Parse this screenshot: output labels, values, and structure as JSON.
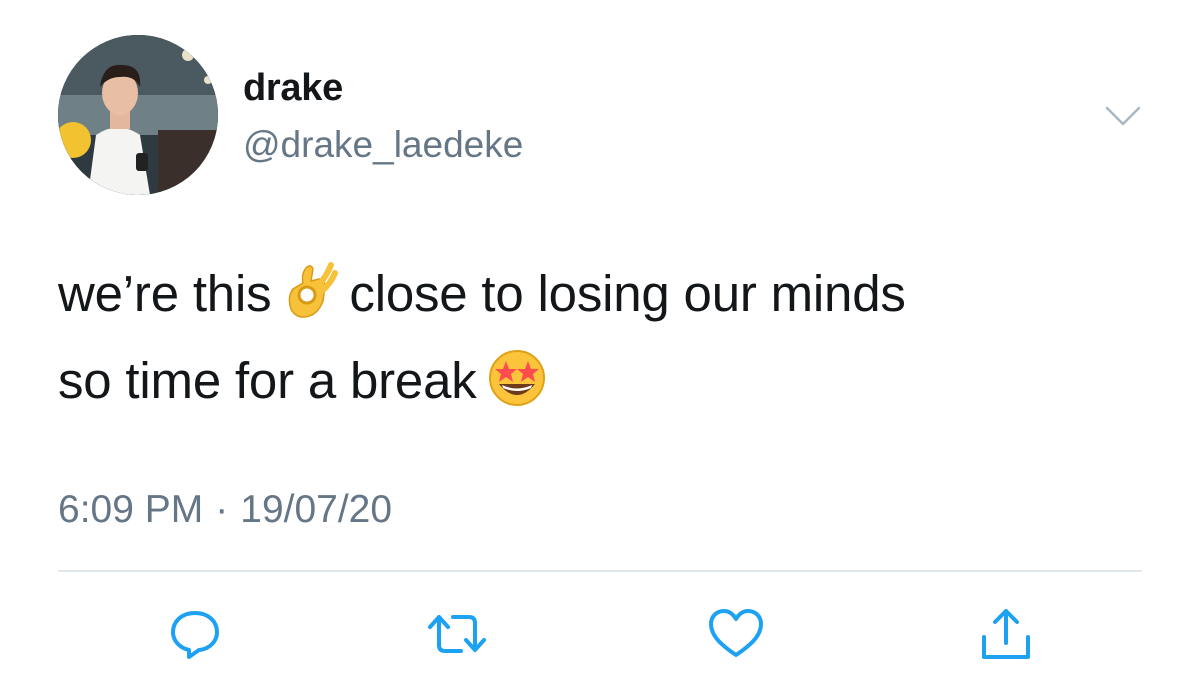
{
  "user": {
    "display_name": "drake",
    "handle": "@drake_laedeke"
  },
  "tweet": {
    "line1_part1": "we’re this",
    "line1_emoji": "ok-hand-emoji",
    "line1_part2": "close to losing our minds",
    "line2_part1": "so time for a break",
    "line2_emoji": "star-struck-emoji",
    "time": "6:09 PM",
    "separator": "·",
    "date": "19/07/20"
  },
  "actions": {
    "reply_icon": "speech-bubble-icon",
    "retweet_icon": "retweet-icon",
    "like_icon": "heart-icon",
    "share_icon": "share-icon"
  },
  "colors": {
    "text": "#14171a",
    "secondary": "#657786",
    "icon": "#1da1f2",
    "divider": "#e1e8ed"
  }
}
